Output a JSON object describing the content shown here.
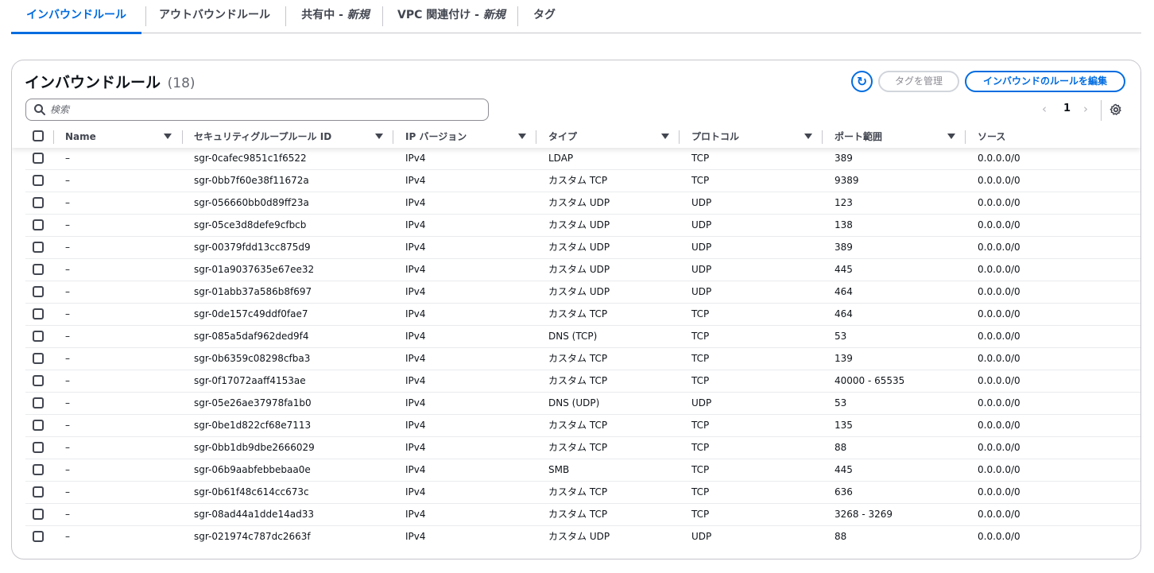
{
  "tabs": [
    {
      "label": "インバウンドルール",
      "suffix": ""
    },
    {
      "label": "アウトバウンドルール",
      "suffix": ""
    },
    {
      "label": "共有中 - ",
      "suffix": "新規"
    },
    {
      "label": "VPC 関連付け - ",
      "suffix": "新規"
    },
    {
      "label": "タグ",
      "suffix": ""
    }
  ],
  "panel": {
    "title": "インバウンドルール",
    "count": "(18)",
    "refresh_label": "↻",
    "manage_tags_label": "タグを管理",
    "edit_rules_label": "インバウンドのルールを編集"
  },
  "search": {
    "placeholder": "検索",
    "value": ""
  },
  "pagination": {
    "prev": "‹",
    "page": "1",
    "next": "›"
  },
  "table": {
    "columns": [
      "Name",
      "セキュリティグループルール ID",
      "IP バージョン",
      "タイプ",
      "プロトコル",
      "ポート範囲",
      "ソース"
    ],
    "rows": [
      [
        "–",
        "sgr-0cafec9851c1f6522",
        "IPv4",
        "LDAP",
        "TCP",
        "389",
        "0.0.0.0/0"
      ],
      [
        "–",
        "sgr-0bb7f60e38f11672a",
        "IPv4",
        "カスタム TCP",
        "TCP",
        "9389",
        "0.0.0.0/0"
      ],
      [
        "–",
        "sgr-056660bb0d89ff23a",
        "IPv4",
        "カスタム UDP",
        "UDP",
        "123",
        "0.0.0.0/0"
      ],
      [
        "–",
        "sgr-05ce3d8defe9cfbcb",
        "IPv4",
        "カスタム UDP",
        "UDP",
        "138",
        "0.0.0.0/0"
      ],
      [
        "–",
        "sgr-00379fdd13cc875d9",
        "IPv4",
        "カスタム UDP",
        "UDP",
        "389",
        "0.0.0.0/0"
      ],
      [
        "–",
        "sgr-01a9037635e67ee32",
        "IPv4",
        "カスタム UDP",
        "UDP",
        "445",
        "0.0.0.0/0"
      ],
      [
        "–",
        "sgr-01abb37a586b8f697",
        "IPv4",
        "カスタム UDP",
        "UDP",
        "464",
        "0.0.0.0/0"
      ],
      [
        "–",
        "sgr-0de157c49ddf0fae7",
        "IPv4",
        "カスタム TCP",
        "TCP",
        "464",
        "0.0.0.0/0"
      ],
      [
        "–",
        "sgr-085a5daf962ded9f4",
        "IPv4",
        "DNS (TCP)",
        "TCP",
        "53",
        "0.0.0.0/0"
      ],
      [
        "–",
        "sgr-0b6359c08298cfba3",
        "IPv4",
        "カスタム TCP",
        "TCP",
        "139",
        "0.0.0.0/0"
      ],
      [
        "–",
        "sgr-0f17072aaff4153ae",
        "IPv4",
        "カスタム TCP",
        "TCP",
        "40000 - 65535",
        "0.0.0.0/0"
      ],
      [
        "–",
        "sgr-05e26ae37978fa1b0",
        "IPv4",
        "DNS (UDP)",
        "UDP",
        "53",
        "0.0.0.0/0"
      ],
      [
        "–",
        "sgr-0be1d822cf68e7113",
        "IPv4",
        "カスタム TCP",
        "TCP",
        "135",
        "0.0.0.0/0"
      ],
      [
        "–",
        "sgr-0bb1db9dbe2666029",
        "IPv4",
        "カスタム TCP",
        "TCP",
        "88",
        "0.0.0.0/0"
      ],
      [
        "–",
        "sgr-06b9aabfebbebaa0e",
        "IPv4",
        "SMB",
        "TCP",
        "445",
        "0.0.0.0/0"
      ],
      [
        "–",
        "sgr-0b61f48c614cc673c",
        "IPv4",
        "カスタム TCP",
        "TCP",
        "636",
        "0.0.0.0/0"
      ],
      [
        "–",
        "sgr-08ad44a1dde14ad33",
        "IPv4",
        "カスタム TCP",
        "TCP",
        "3268 - 3269",
        "0.0.0.0/0"
      ],
      [
        "–",
        "sgr-021974c787dc2663f",
        "IPv4",
        "カスタム UDP",
        "UDP",
        "88",
        "0.0.0.0/0"
      ]
    ]
  },
  "icons": {
    "search": "search-icon",
    "refresh": "refresh-icon",
    "settings": "gear-icon",
    "sort": "sort-icon",
    "pager_prev": "chevron-left-icon",
    "pager_next": "chevron-right-icon"
  },
  "colors": {
    "accent": "#006ce0",
    "text": "#0f141a",
    "muted": "#424650",
    "border": "#c6c6cd",
    "disabled": "#8c8c94"
  }
}
